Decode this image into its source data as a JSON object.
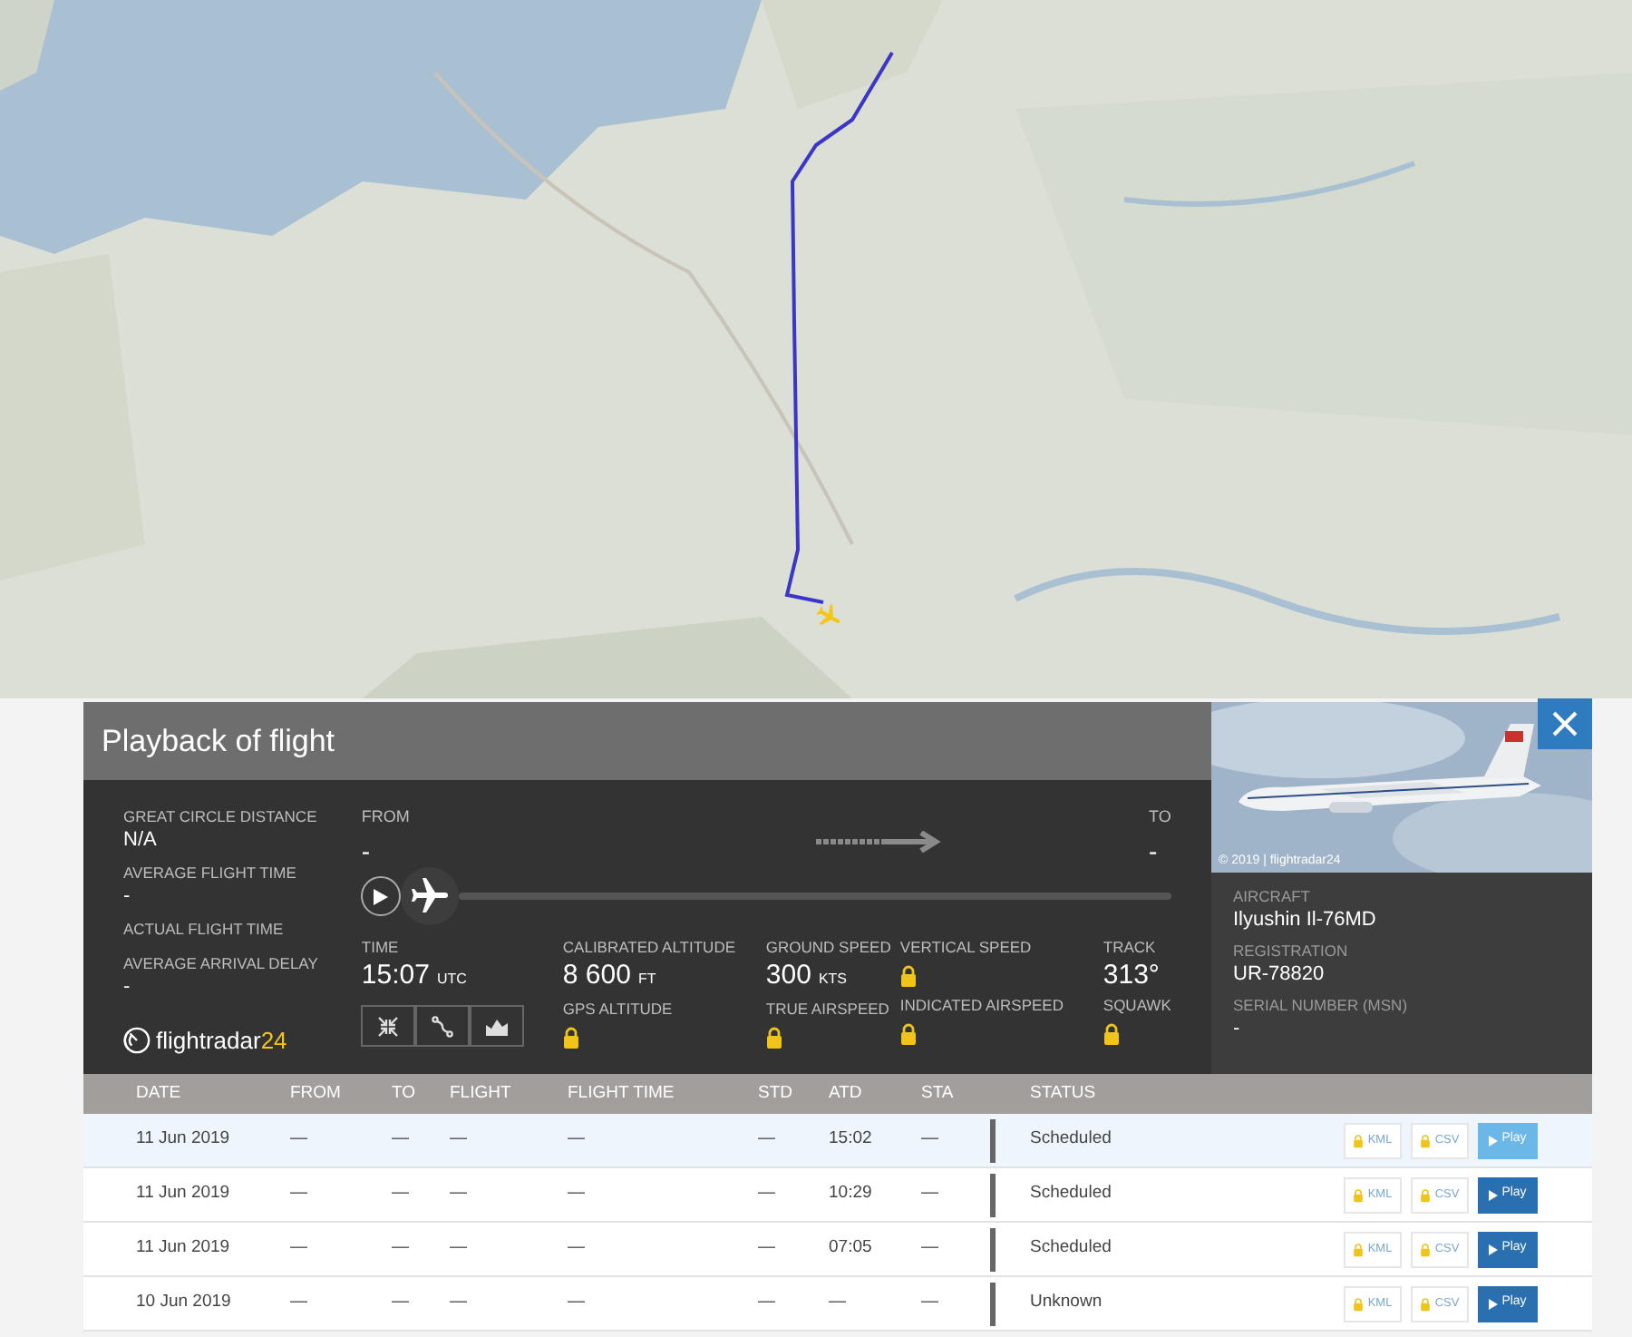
{
  "panel": {
    "title": "Playback of flight",
    "summary": [
      {
        "label": "GREAT CIRCLE DISTANCE",
        "value": "N/A"
      },
      {
        "label": "AVERAGE FLIGHT TIME",
        "value": "-"
      },
      {
        "label": "ACTUAL FLIGHT TIME"
      },
      {
        "label": "AVERAGE ARRIVAL DELAY",
        "value": "-"
      }
    ],
    "logo": {
      "word": "flightradar",
      "number": "24"
    },
    "route": {
      "from_label": "FROM",
      "from": "-",
      "to_label": "TO",
      "to": "-"
    },
    "playback": {
      "level": 0
    },
    "stat_columns": [
      [
        {
          "kind": "value",
          "label": "TIME",
          "value": "15:07",
          "unit": "UTC"
        }
      ],
      [
        {
          "kind": "value",
          "label": "CALIBRATED ALTITUDE",
          "value": "8 600",
          "unit": "FT"
        },
        {
          "kind": "locked",
          "label": "GPS ALTITUDE"
        }
      ],
      [
        {
          "kind": "value",
          "label": "GROUND SPEED",
          "value": "300",
          "unit": "KTS"
        },
        {
          "kind": "locked",
          "label": "TRUE AIRSPEED"
        }
      ],
      [
        {
          "kind": "locked",
          "label": "VERTICAL SPEED"
        },
        {
          "kind": "locked",
          "label": "INDICATED AIRSPEED"
        }
      ],
      [
        {
          "kind": "value",
          "label": "TRACK",
          "value": "313°"
        },
        {
          "kind": "locked",
          "label": "SQUAWK"
        }
      ]
    ],
    "view_buttons": [
      {
        "kind": "center"
      },
      {
        "kind": "route"
      },
      {
        "kind": "chart"
      }
    ],
    "aircraft": {
      "photo_credit": "© 2019 | flightradar24",
      "fields": [
        {
          "label": "AIRCRAFT",
          "value": "Ilyushin Il-76MD"
        },
        {
          "label": "REGISTRATION",
          "value": "UR-78820"
        },
        {
          "label": "SERIAL NUMBER (MSN)",
          "value": "-"
        }
      ]
    }
  },
  "table": {
    "columns": [
      "DATE",
      "FROM",
      "TO",
      "FLIGHT",
      "FLIGHT TIME",
      "STD",
      "ATD",
      "STA",
      "STATUS"
    ],
    "rows": [
      {
        "selected": true,
        "cells": [
          "11 Jun 2019",
          "—",
          "—",
          "—",
          "—",
          "—",
          "15:02",
          "—",
          "Scheduled"
        ],
        "kml": "KML",
        "csv": "CSV",
        "play": "Play"
      },
      {
        "selected": false,
        "cells": [
          "11 Jun 2019",
          "—",
          "—",
          "—",
          "—",
          "—",
          "10:29",
          "—",
          "Scheduled"
        ],
        "kml": "KML",
        "csv": "CSV",
        "play": "Play"
      },
      {
        "selected": false,
        "cells": [
          "11 Jun 2019",
          "—",
          "—",
          "—",
          "—",
          "—",
          "07:05",
          "—",
          "Scheduled"
        ],
        "kml": "KML",
        "csv": "CSV",
        "play": "Play"
      },
      {
        "selected": false,
        "cells": [
          "10 Jun 2019",
          "—",
          "—",
          "—",
          "—",
          "—",
          "—",
          "—",
          "Unknown"
        ],
        "kml": "KML",
        "csv": "CSV",
        "play": "Play"
      }
    ]
  }
}
